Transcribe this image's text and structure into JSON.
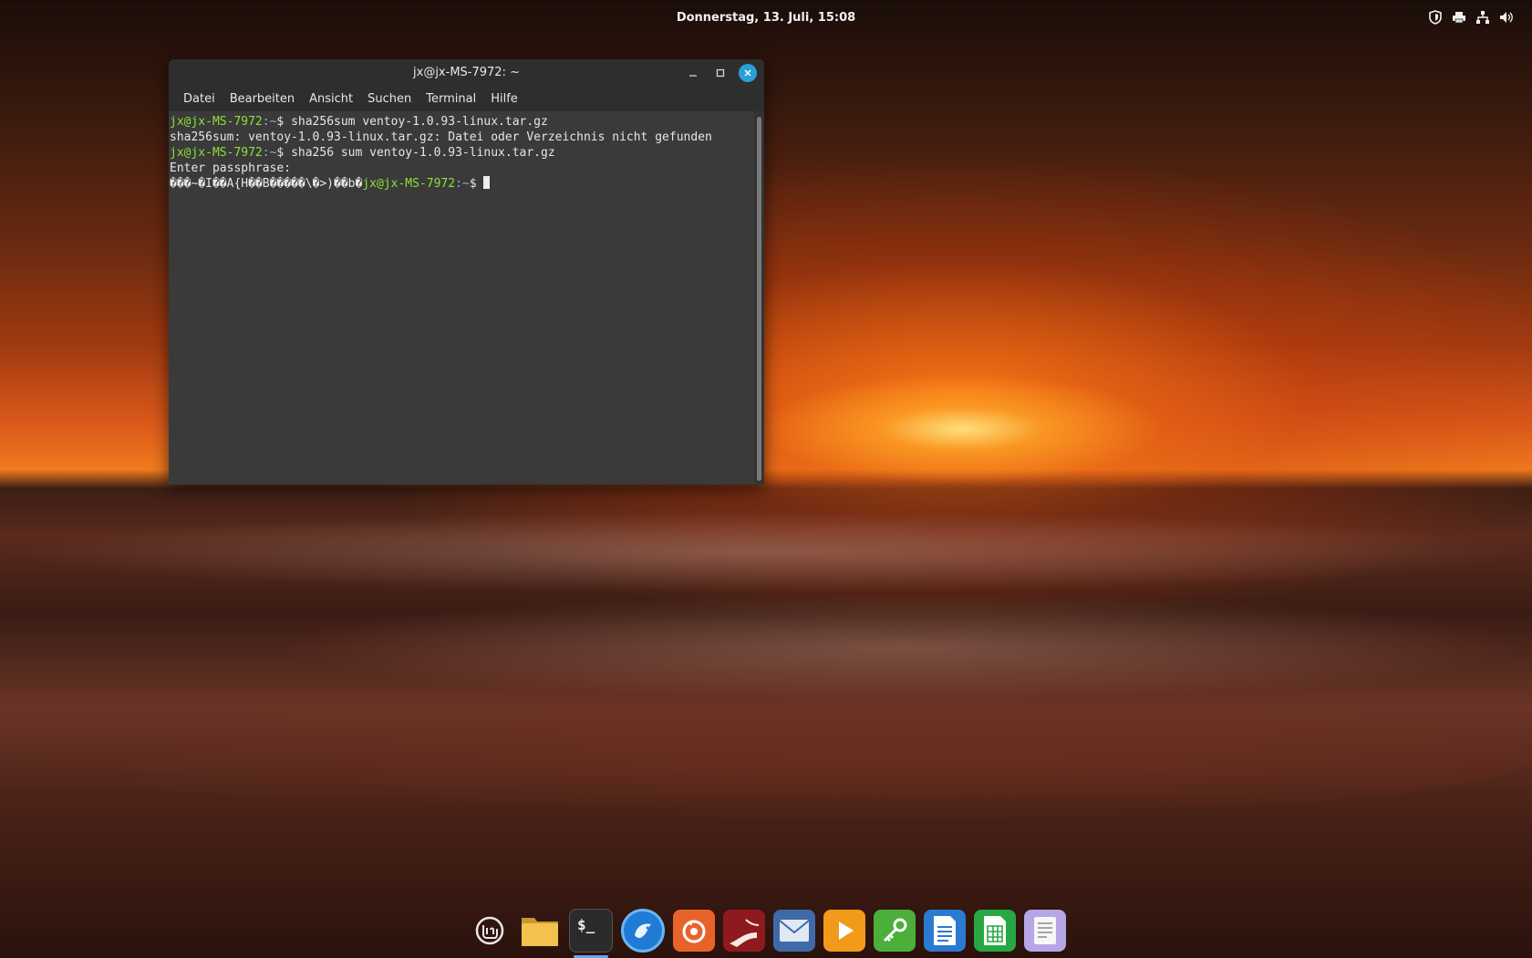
{
  "panel": {
    "clock": "Donnerstag, 13. Juli, 15:08",
    "tray_icons": [
      "shield-icon",
      "printer-icon",
      "network-icon",
      "volume-icon"
    ]
  },
  "terminal": {
    "title": "jx@jx-MS-7972: ~",
    "menu": [
      "Datei",
      "Bearbeiten",
      "Ansicht",
      "Suchen",
      "Terminal",
      "Hilfe"
    ],
    "lines": [
      {
        "user": "jx@jx-MS-7972",
        "path": ":~",
        "symbol": "$ ",
        "text": "sha256sum ventoy-1.0.93-linux.tar.gz"
      },
      {
        "text": "sha256sum: ventoy-1.0.93-linux.tar.gz: Datei oder Verzeichnis nicht gefunden"
      },
      {
        "user": "jx@jx-MS-7972",
        "path": ":~",
        "symbol": "$ ",
        "text": "sha256 sum ventoy-1.0.93-linux.tar.gz"
      },
      {
        "text": "Enter passphrase:"
      },
      {
        "garbage": "���~�I��A{H��B�����\\�>)��b�",
        "user": "jx@jx-MS-7972",
        "path": ":~",
        "symbol": "$ ",
        "text": "",
        "cursor": true
      }
    ]
  },
  "dock": {
    "items": [
      "mint-menu-icon",
      "files-icon",
      "terminal-icon",
      "thunderbird-icon",
      "firefox-icon",
      "timeshift-icon",
      "mail-icon",
      "media-player-icon",
      "passwords-icon",
      "writer-icon",
      "calc-icon",
      "text-editor-icon"
    ],
    "terminal_glyph": "$_"
  }
}
